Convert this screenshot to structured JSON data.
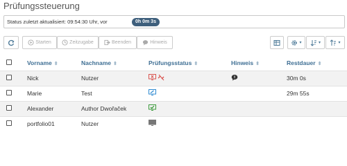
{
  "page": {
    "title": "Prüfungssteuerung"
  },
  "status": {
    "text": "Status zuletzt aktualisiert: 09:54:30 Uhr, vor",
    "badge": "0h 0m 3s"
  },
  "toolbar": {
    "start_label": "Starten",
    "extra_time_label": "Zeitzugabe",
    "end_label": "Beenden",
    "hint_label": "Hinweis"
  },
  "table": {
    "headers": {
      "firstname": "Vorname",
      "lastname": "Nachname",
      "status": "Prüfungsstatus",
      "hint": "Hinweis",
      "remaining": "Restdauer"
    },
    "rows": [
      {
        "firstname": "Nick",
        "lastname": "Nutzer",
        "status_icons": [
          "monitor-error-icon",
          "link-broken-icon"
        ],
        "hint_icon": "comment-icon",
        "remaining": "30m 0s"
      },
      {
        "firstname": "Marie",
        "lastname": "Test",
        "status_icons": [
          "monitor-pencil-icon"
        ],
        "hint_icon": "",
        "remaining": "29m 55s"
      },
      {
        "firstname": "Alexander",
        "lastname": "Author Dwořaček",
        "status_icons": [
          "monitor-check-icon"
        ],
        "hint_icon": "",
        "remaining": ""
      },
      {
        "firstname": "portfolio01",
        "lastname": "Nutzer",
        "status_icons": [
          "monitor-idle-icon"
        ],
        "hint_icon": "",
        "remaining": ""
      }
    ]
  },
  "colors": {
    "accent": "#3f6f94",
    "badge": "#3e5f7c",
    "error": "#d9534f",
    "ok": "#3c9a3c",
    "edit": "#2d8ad1",
    "idle": "#777777"
  }
}
